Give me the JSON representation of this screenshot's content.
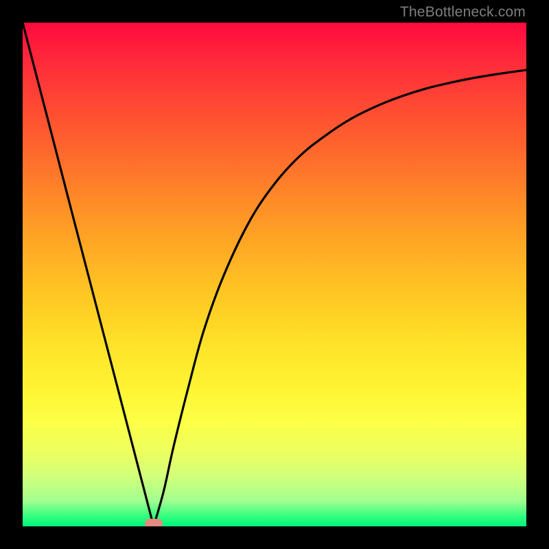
{
  "attribution": "TheBottleneck.com",
  "colors": {
    "background": "#000000",
    "curve": "#000000",
    "marker": "#e58a80",
    "attribution_text": "#7f7f7f"
  },
  "chart_data": {
    "type": "line",
    "title": "",
    "xlabel": "",
    "ylabel": "",
    "xlim": [
      0,
      100
    ],
    "ylim": [
      0,
      100
    ],
    "grid": false,
    "legend": false,
    "annotations": [],
    "background_gradient": {
      "direction": "top-to-bottom",
      "stops": [
        {
          "pos": 0.0,
          "color": "#ff0a3f"
        },
        {
          "pos": 0.5,
          "color": "#ffc020"
        },
        {
          "pos": 0.78,
          "color": "#fcff45"
        },
        {
          "pos": 1.0,
          "color": "#00f57a"
        }
      ]
    },
    "marker": {
      "x": 26,
      "y": 0,
      "shape": "pill",
      "color": "#e58a80"
    },
    "series": [
      {
        "name": "left-descent",
        "x": [
          0,
          5,
          10,
          15,
          20,
          24,
          26
        ],
        "y": [
          100,
          80.8,
          61.5,
          42.3,
          23.1,
          7.7,
          0
        ]
      },
      {
        "name": "right-curve",
        "x": [
          26,
          28,
          30,
          33,
          36,
          40,
          45,
          50,
          55,
          60,
          65,
          70,
          75,
          80,
          85,
          90,
          95,
          100
        ],
        "y": [
          0,
          7,
          16,
          28,
          39,
          50,
          60.5,
          68,
          73.5,
          77.5,
          80.8,
          83.3,
          85.3,
          86.9,
          88.1,
          89.1,
          89.9,
          90.6
        ]
      }
    ]
  }
}
